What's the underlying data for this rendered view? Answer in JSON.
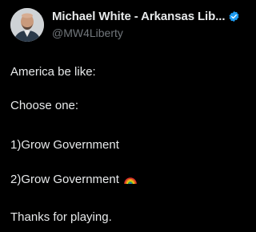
{
  "author": {
    "display_name": "Michael White - Arkansas Lib...",
    "handle": "@MW4Liberty",
    "verified_icon": "verified-badge-icon",
    "verified_color": "#1d9bf0"
  },
  "post": {
    "lines": [
      "America be like:",
      "Choose one:",
      "1)Grow Government",
      "2)Grow Government",
      "Thanks for playing."
    ],
    "emoji_icon": "rainbow-icon"
  },
  "colors": {
    "background": "#000000",
    "text": "#e7e9ea",
    "secondary": "#71767b"
  }
}
